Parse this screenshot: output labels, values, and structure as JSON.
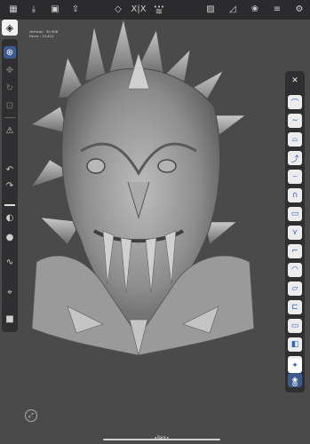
{
  "topbar": {
    "icons": [
      "grid-icon",
      "download-icon",
      "save-icon",
      "export-icon",
      "box-icon",
      "symmetry-icon",
      "layers-icon",
      "image-icon",
      "chart-icon",
      "material-icon",
      "sliders-icon",
      "settings-icon"
    ],
    "symmetry_label": "X|X",
    "more_label": "•••"
  },
  "stats": {
    "vertices": "Vertices : 30,908",
    "faces": "Faces      : 15,812"
  },
  "bottom": {
    "back_label": "◂ Back ▸"
  },
  "colors": {
    "accent": "#3b5b8f",
    "brand_blue": "#2e63c8",
    "panel": "#2f2f31",
    "background": "#4a4a4a"
  }
}
